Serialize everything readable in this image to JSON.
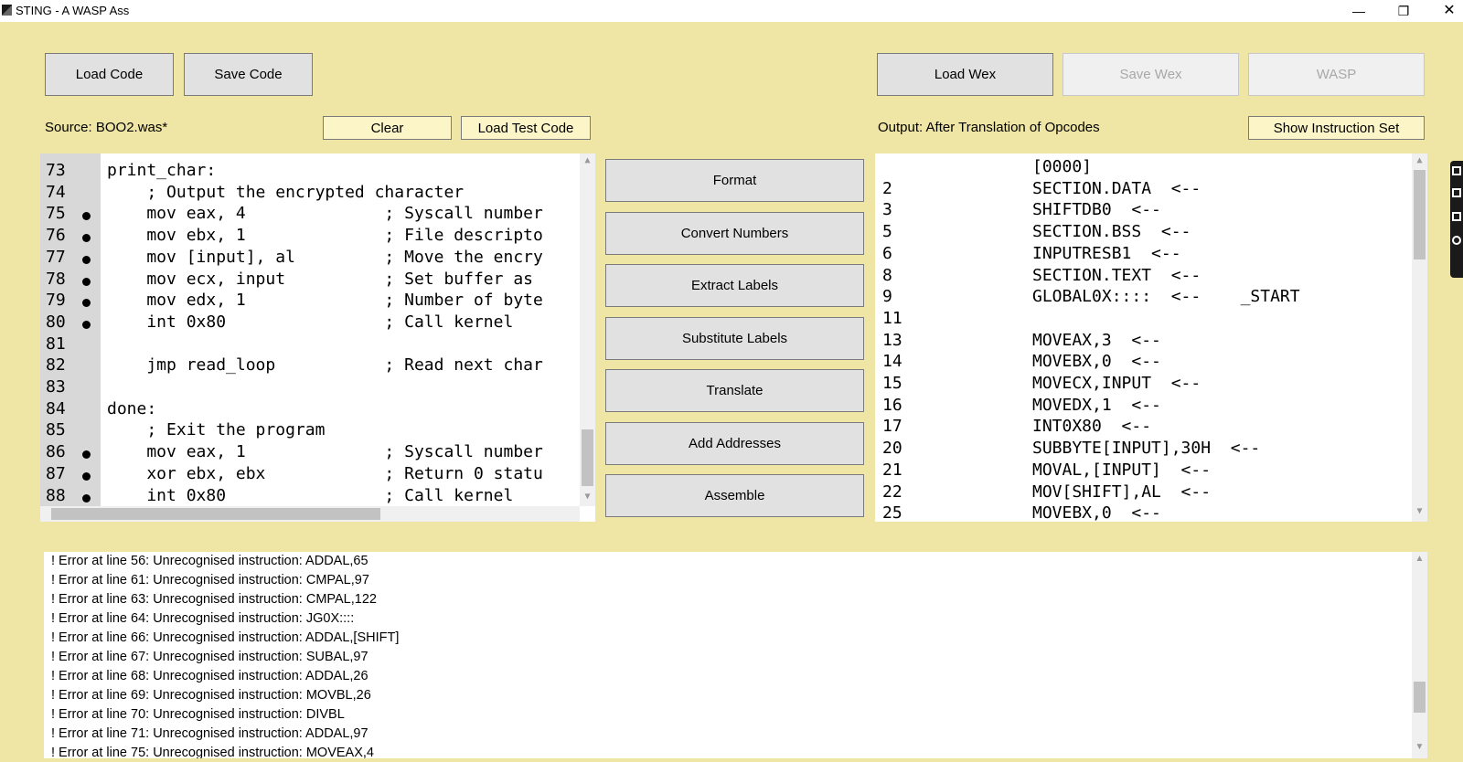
{
  "window": {
    "title": "STING - A WASP Ass",
    "minimize": "—",
    "maximize": "❐",
    "close": "✕"
  },
  "toolbar": {
    "load_code": "Load Code",
    "save_code": "Save Code",
    "load_wex": "Load Wex",
    "save_wex": "Save Wex",
    "wasp": "WASP"
  },
  "source_label": "Source: BOO2.was*",
  "clear": "Clear",
  "load_test_code": "Load Test Code",
  "output_label": "Output: After Translation of Opcodes",
  "show_instruction_set": "Show Instruction Set",
  "actions": [
    "Format",
    "Convert Numbers",
    "Extract Labels",
    "Substitute Labels",
    "Translate",
    "Add Addresses",
    "Assemble"
  ],
  "code_lines": [
    {
      "n": "73",
      "bp": false,
      "text": "print_char:"
    },
    {
      "n": "74",
      "bp": false,
      "text": "    ; Output the encrypted character"
    },
    {
      "n": "75",
      "bp": true,
      "text": "    mov eax, 4              ; Syscall number"
    },
    {
      "n": "76",
      "bp": true,
      "text": "    mov ebx, 1              ; File descripto"
    },
    {
      "n": "77",
      "bp": true,
      "text": "    mov [input], al         ; Move the encry"
    },
    {
      "n": "78",
      "bp": true,
      "text": "    mov ecx, input          ; Set buffer as"
    },
    {
      "n": "79",
      "bp": true,
      "text": "    mov edx, 1              ; Number of byte"
    },
    {
      "n": "80",
      "bp": true,
      "text": "    int 0x80                ; Call kernel"
    },
    {
      "n": "81",
      "bp": false,
      "text": ""
    },
    {
      "n": "82",
      "bp": false,
      "text": "    jmp read_loop           ; Read next char"
    },
    {
      "n": "83",
      "bp": false,
      "text": ""
    },
    {
      "n": "84",
      "bp": false,
      "text": "done:"
    },
    {
      "n": "85",
      "bp": false,
      "text": "    ; Exit the program"
    },
    {
      "n": "86",
      "bp": true,
      "text": "    mov eax, 1              ; Syscall number"
    },
    {
      "n": "87",
      "bp": true,
      "text": "    xor ebx, ebx            ; Return 0 statu"
    },
    {
      "n": "88",
      "bp": true,
      "text": "    int 0x80                ; Call kernel"
    }
  ],
  "output_lines": [
    {
      "n": "",
      "text": "[0000]"
    },
    {
      "n": "2",
      "text": "SECTION.DATA  <--"
    },
    {
      "n": "3",
      "text": "SHIFTDB0  <--"
    },
    {
      "n": "5",
      "text": "SECTION.BSS  <--"
    },
    {
      "n": "6",
      "text": "INPUTRESB1  <--"
    },
    {
      "n": "8",
      "text": "SECTION.TEXT  <--"
    },
    {
      "n": "9",
      "text": "GLOBAL0X::::  <--    _START"
    },
    {
      "n": "11",
      "text": ""
    },
    {
      "n": "13",
      "text": "MOVEAX,3  <--"
    },
    {
      "n": "14",
      "text": "MOVEBX,0  <--"
    },
    {
      "n": "15",
      "text": "MOVECX,INPUT  <--"
    },
    {
      "n": "16",
      "text": "MOVEDX,1  <--"
    },
    {
      "n": "17",
      "text": "INT0X80  <--"
    },
    {
      "n": "20",
      "text": "SUBBYTE[INPUT],30H  <--"
    },
    {
      "n": "21",
      "text": "MOVAL,[INPUT]  <--"
    },
    {
      "n": "22",
      "text": "MOV[SHIFT],AL  <--"
    },
    {
      "n": "25",
      "text": "MOVEBX,0  <--"
    }
  ],
  "errors": [
    "! Error at line 56: Unrecognised instruction: ADDAL,65",
    "! Error at line 61: Unrecognised instruction: CMPAL,97",
    "! Error at line 63: Unrecognised instruction: CMPAL,122",
    "! Error at line 64: Unrecognised instruction: JG0X::::",
    "! Error at line 66: Unrecognised instruction: ADDAL,[SHIFT]",
    "! Error at line 67: Unrecognised instruction: SUBAL,97",
    "! Error at line 68: Unrecognised instruction: ADDAL,26",
    "! Error at line 69: Unrecognised instruction: MOVBL,26",
    "! Error at line 70: Unrecognised instruction: DIVBL",
    "! Error at line 71: Unrecognised instruction: ADDAL,97",
    "! Error at line 75: Unrecognised instruction: MOVEAX,4"
  ],
  "colors": {
    "background": "#efe5a5",
    "button": "#e1e1e1",
    "button_light": "#fbf5c8",
    "gutter": "#d8d8d8"
  }
}
